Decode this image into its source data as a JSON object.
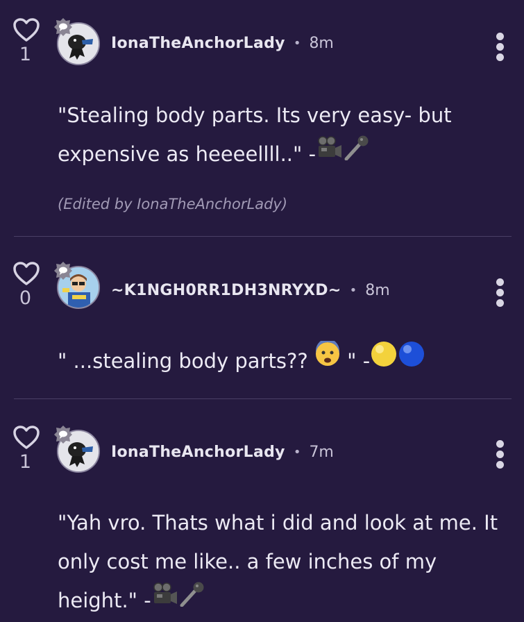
{
  "comments": [
    {
      "likes": "1",
      "username": "IonaTheAnchorLady",
      "separator": "•",
      "time": "8m",
      "text": "\"Stealing body parts. Its very easy- but expensive as heeeellll..\" -",
      "edited": "(Edited by IonaTheAnchorLady)",
      "signature_icons": [
        "movie-camera-icon",
        "microphone-icon"
      ]
    },
    {
      "likes": "0",
      "username": "~K1NGH0RR1DH3NRYXD~",
      "separator": "•",
      "time": "8m",
      "text": "\" ...stealing body parts?? ",
      "text_end": " \" -",
      "signature_icons": [
        "fearful-face-icon",
        "yellow-circle-icon",
        "blue-circle-icon"
      ]
    },
    {
      "likes": "1",
      "username": "IonaTheAnchorLady",
      "separator": "•",
      "time": "7m",
      "text": "\"Yah vro. Thats what i did and look at me. It only cost me like.. a few inches of my height.\" -",
      "signature_icons": [
        "movie-camera-icon",
        "microphone-icon"
      ]
    }
  ],
  "colors": {
    "background": "#251a3f",
    "divider": "#4a3f66",
    "text": "#eceaf4",
    "muted": "#a29bb6"
  }
}
